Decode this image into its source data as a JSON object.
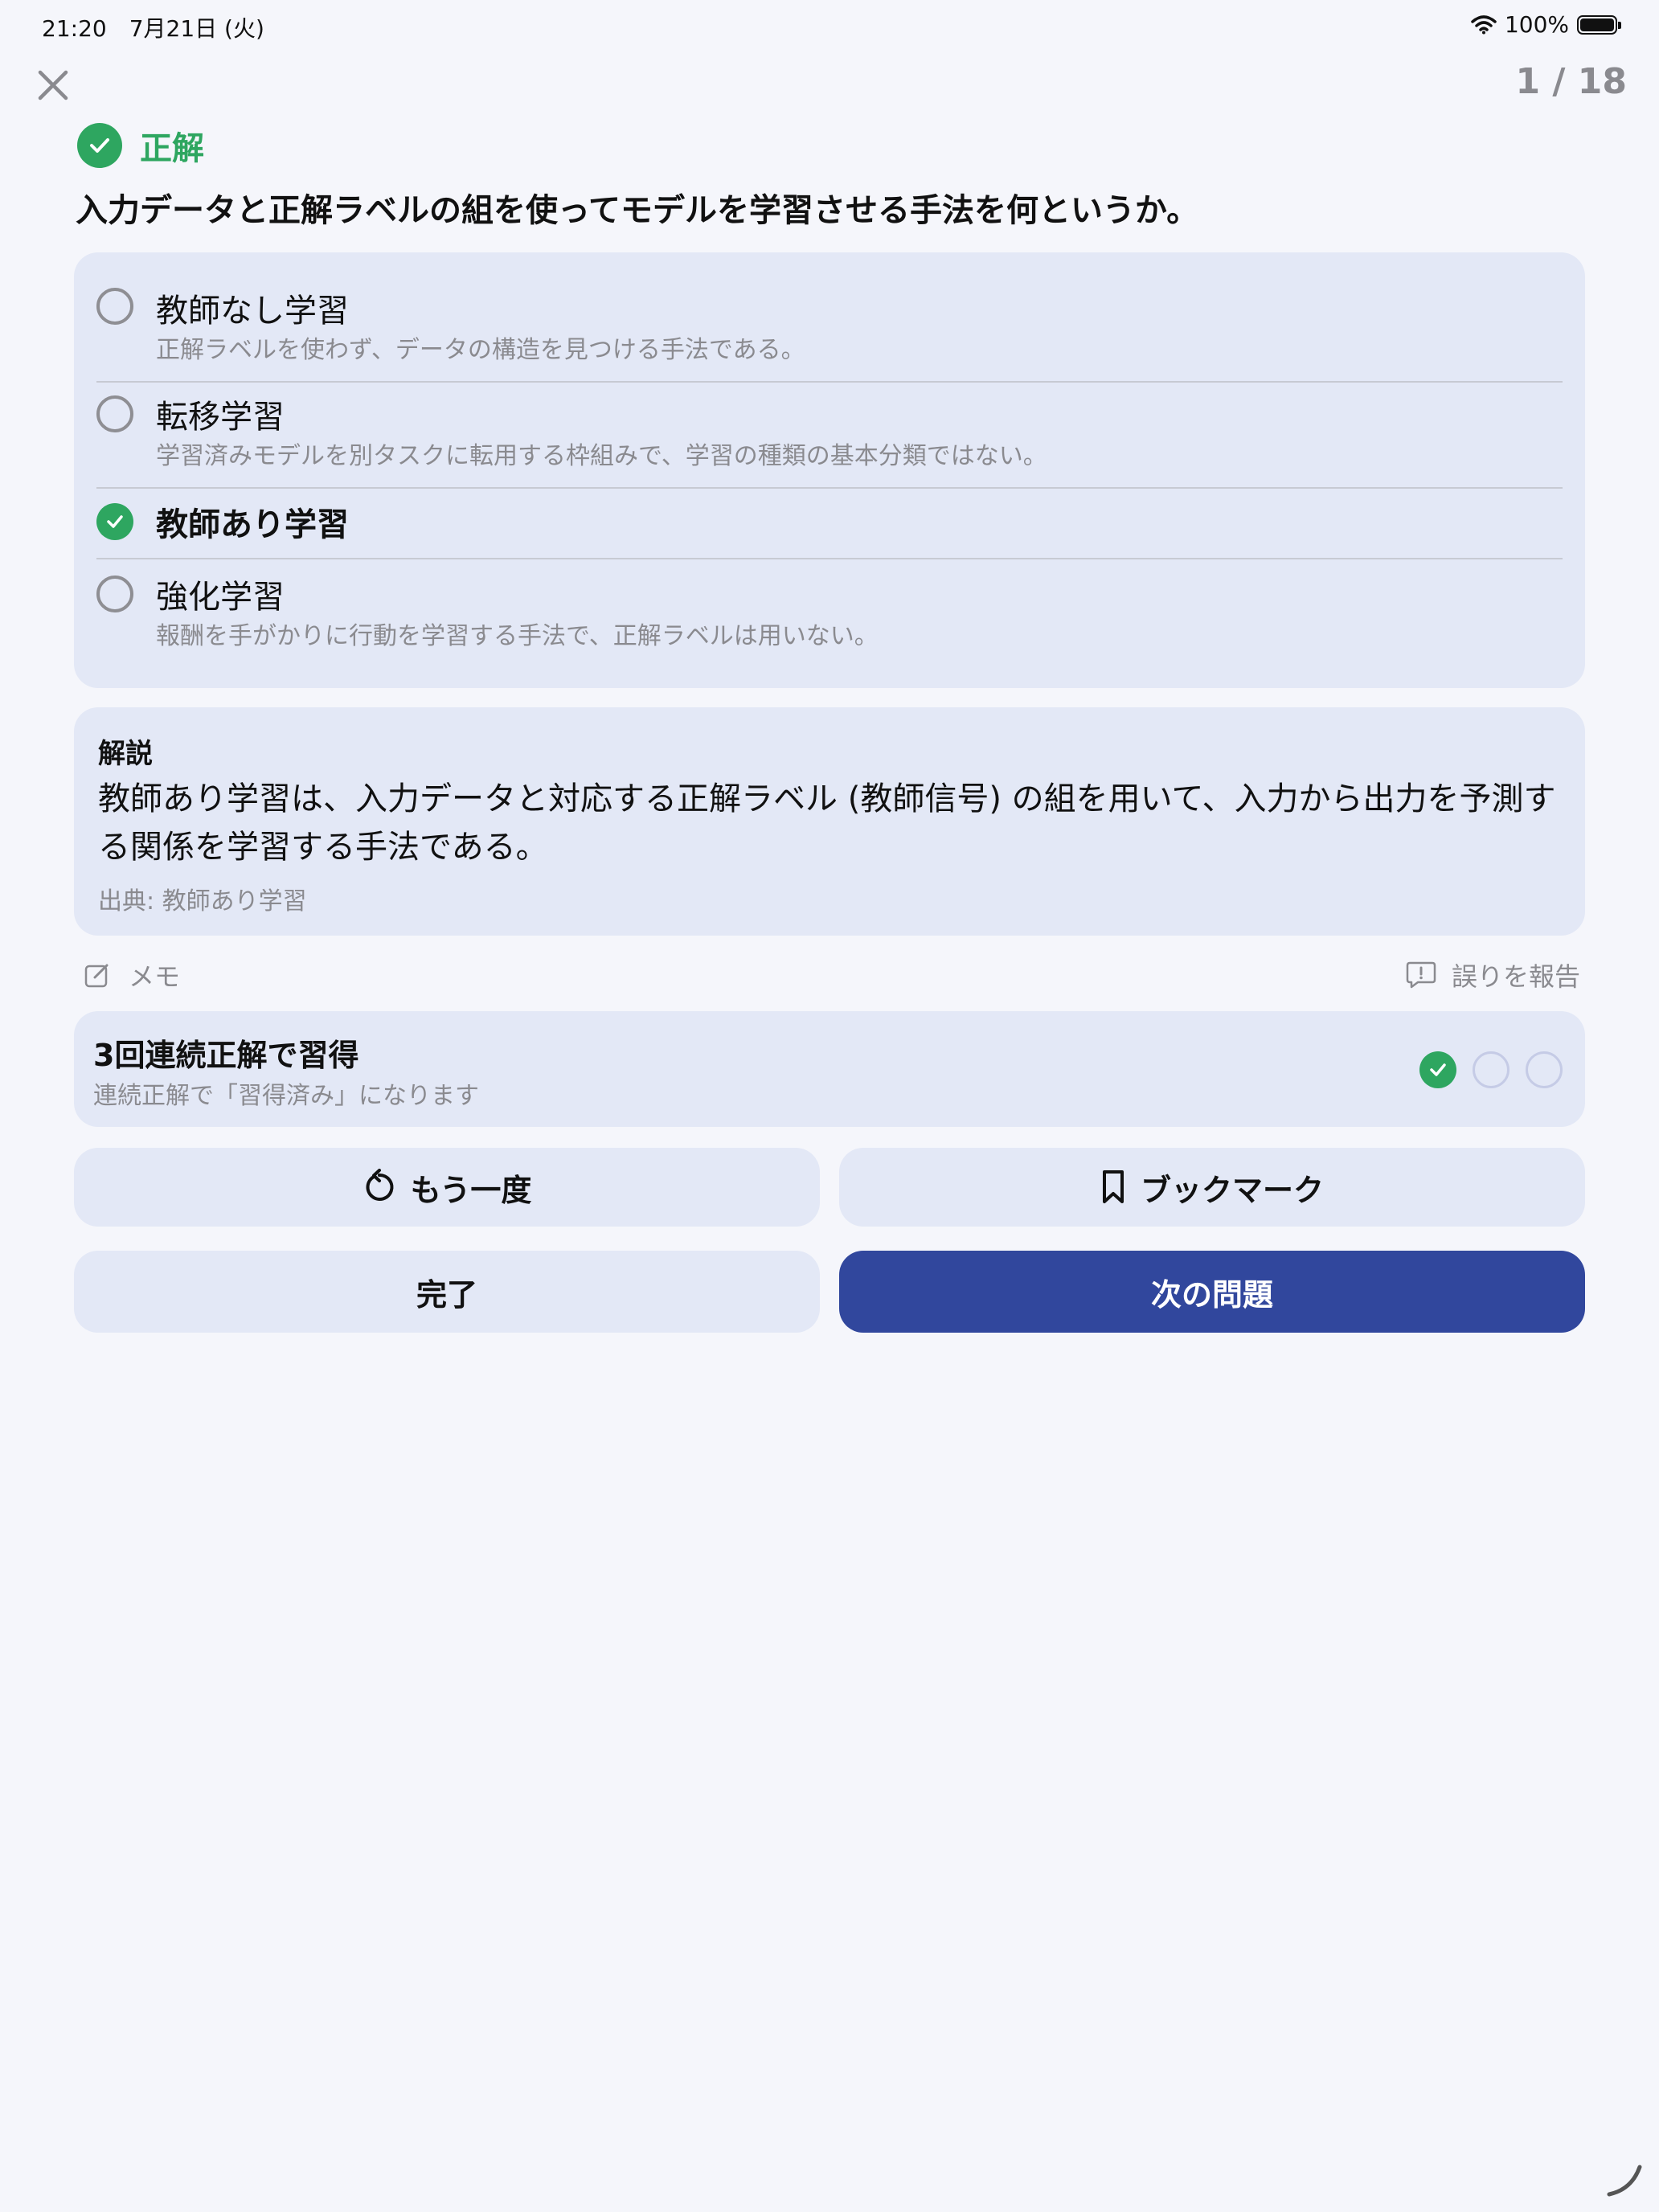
{
  "status_bar": {
    "time": "21:20　7月21日 (火)",
    "battery": "100%",
    "battery_level": 1.0
  },
  "header": {
    "progress": "1 / 18"
  },
  "result": {
    "label": "正解"
  },
  "question": {
    "text": "入力データと正解ラベルの組を使ってモデルを学習させる手法を何というか。"
  },
  "options": [
    {
      "title": "教師なし学習",
      "description": "正解ラベルを使わず、データの構造を見つける手法である。",
      "correct": false
    },
    {
      "title": "転移学習",
      "description": "学習済みモデルを別タスクに転用する枠組みで、学習の種類の基本分類ではない。",
      "correct": false
    },
    {
      "title": "教師あり学習",
      "description": "",
      "correct": true
    },
    {
      "title": "強化学習",
      "description": "報酬を手がかりに行動を学習する手法で、正解ラベルは用いない。",
      "correct": false
    }
  ],
  "explanation": {
    "heading": "解説",
    "body": "教師あり学習は、入力データと対応する正解ラベル (教師信号) の組を用いて、入力から出力を予測する関係を学習する手法である。",
    "source": "出典: 教師あり学習"
  },
  "actions": {
    "memo": "メモ",
    "report": "誤りを報告"
  },
  "mastery": {
    "title": "3回連続正解で習得",
    "subtitle": "連続正解で「習得済み」になります",
    "streak": 1,
    "required": 3
  },
  "buttons": {
    "retry": "もう一度",
    "bookmark": "ブックマーク",
    "done": "完了",
    "next": "次の問題"
  },
  "colors": {
    "accent": "#31479d",
    "correct": "#2ea660",
    "card": "#e3e8f6",
    "background": "#f5f6fb"
  }
}
